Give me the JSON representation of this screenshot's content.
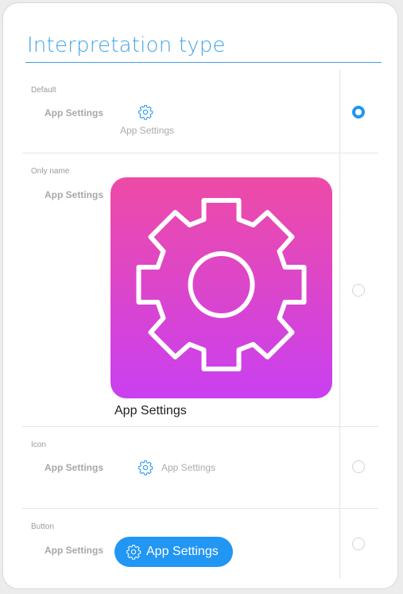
{
  "header": {
    "title": "Interpretation type"
  },
  "options": [
    {
      "section_label": "Default",
      "row_label": "App Settings",
      "preview_text": "App Settings",
      "selected": true
    },
    {
      "section_label": "Only name",
      "row_label": "App Settings",
      "preview_text": "App Settings",
      "selected": false
    },
    {
      "section_label": "Icon",
      "row_label": "App Settings",
      "preview_text": "App Settings",
      "selected": false
    },
    {
      "section_label": "Button",
      "row_label": "App Settings",
      "preview_text": "App Settings",
      "selected": false
    }
  ],
  "icons": {
    "settings": "gear-icon",
    "radio_checked": "radio-checked",
    "radio_unchecked": "radio-unchecked"
  },
  "colors": {
    "accent": "#2196f3",
    "title": "#46a4e6",
    "tile_top": "#ee4ba6",
    "tile_bottom": "#c940f0"
  }
}
